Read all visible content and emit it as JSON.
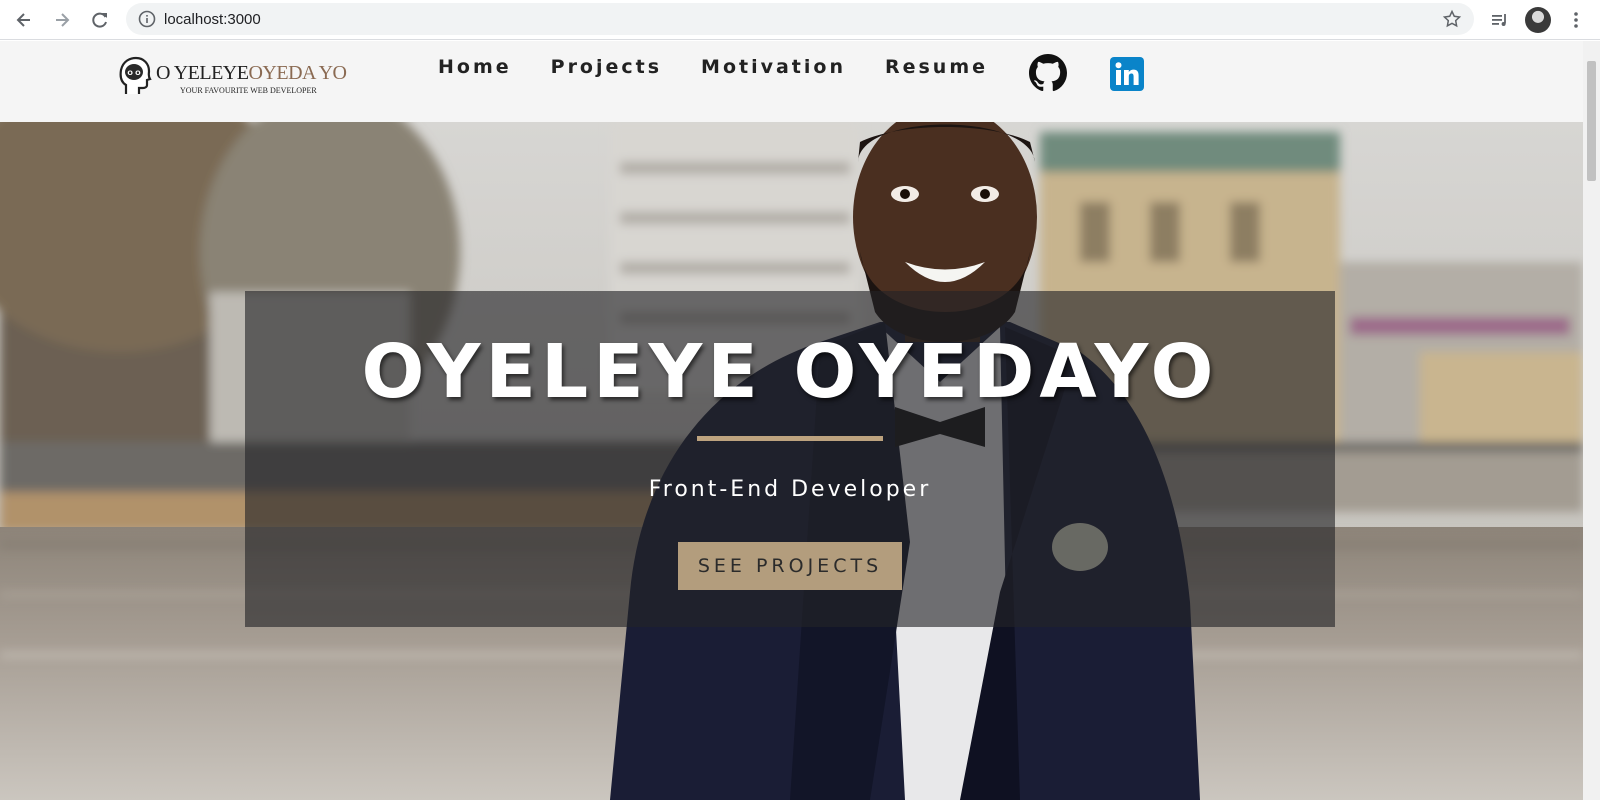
{
  "browser": {
    "url": "localhost:3000",
    "icons": {
      "back": "back-arrow-icon",
      "forward": "forward-arrow-icon",
      "reload": "reload-icon",
      "info": "info-icon",
      "bookmark": "star-icon",
      "media": "media-controls-icon",
      "profile": "avatar",
      "menu": "kebab-menu-icon"
    }
  },
  "site": {
    "logo": {
      "name_part1": "O YELEYE",
      "name_part2": "OYEDA YO",
      "tagline": "YOUR FAVOURITE WEB DEVELOPER"
    },
    "nav": [
      {
        "label": "Home"
      },
      {
        "label": "Projects"
      },
      {
        "label": "Motivation"
      },
      {
        "label": "Resume"
      }
    ],
    "social": [
      {
        "icon": "github-icon",
        "color": "#111111"
      },
      {
        "icon": "linkedin-icon",
        "color": "#0a84c9"
      }
    ]
  },
  "hero": {
    "title": "OYELEYE OYEDAYO",
    "subtitle": "Front-End Developer",
    "cta_label": "SEE PROJECTS",
    "accent_color": "#b39d7d"
  }
}
